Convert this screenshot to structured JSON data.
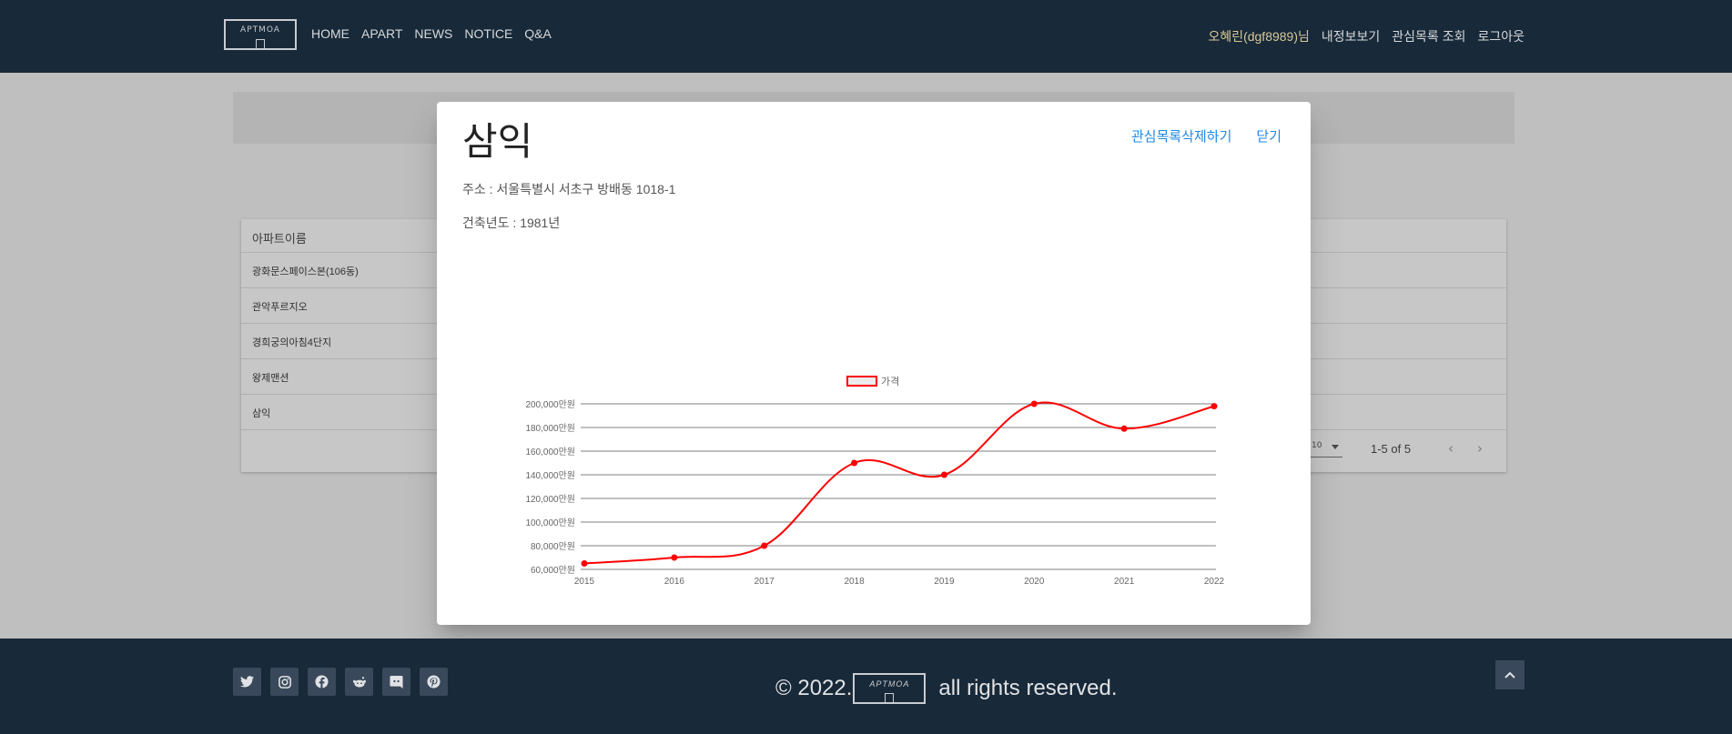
{
  "header": {
    "logo_text": "APTMOA",
    "nav": [
      "HOME",
      "APART",
      "NEWS",
      "NOTICE",
      "Q&A"
    ],
    "user_links": [
      "오혜린(dgf8989)님",
      "내정보보기",
      "관심목록 조회",
      "로그아웃"
    ]
  },
  "table": {
    "column_header": "아파트이름",
    "rows": [
      "광화문스페이스본(106동)",
      "관악푸르지오",
      "경희궁의아침4단지",
      "왕제맨션",
      "삼익"
    ],
    "per_page": "10",
    "range": "1-5 of 5"
  },
  "modal": {
    "title": "삼익",
    "actions": [
      "관심목록삭제하기",
      "닫기"
    ],
    "address": "주소 : 서울특별시 서초구 방배동 1018-1",
    "built_year": "건축년도 : 1981년"
  },
  "chart_data": {
    "type": "line",
    "x": [
      "2015",
      "2016",
      "2017",
      "2018",
      "2019",
      "2020",
      "2021",
      "2022"
    ],
    "series": [
      {
        "name": "가격",
        "values": [
          65000,
          70000,
          80000,
          150000,
          140000,
          200000,
          179000,
          198000
        ],
        "color": "#ff0000"
      }
    ],
    "ylim": [
      60000,
      200000
    ],
    "yticks": [
      "60,000만원",
      "80,000만원",
      "100,000만원",
      "120,000만원",
      "140,000만원",
      "160,000만원",
      "180,000만원",
      "200,000만원"
    ],
    "legend_position": "top-center",
    "grid": true
  },
  "footer": {
    "copyright_prefix": "© 2022.",
    "copyright_suffix": "all rights reserved.",
    "logo_text": "APTMOA",
    "social_icons": [
      "twitter-icon",
      "instagram-icon",
      "facebook-icon",
      "reddit-icon",
      "discord-icon",
      "pinterest-icon"
    ]
  }
}
